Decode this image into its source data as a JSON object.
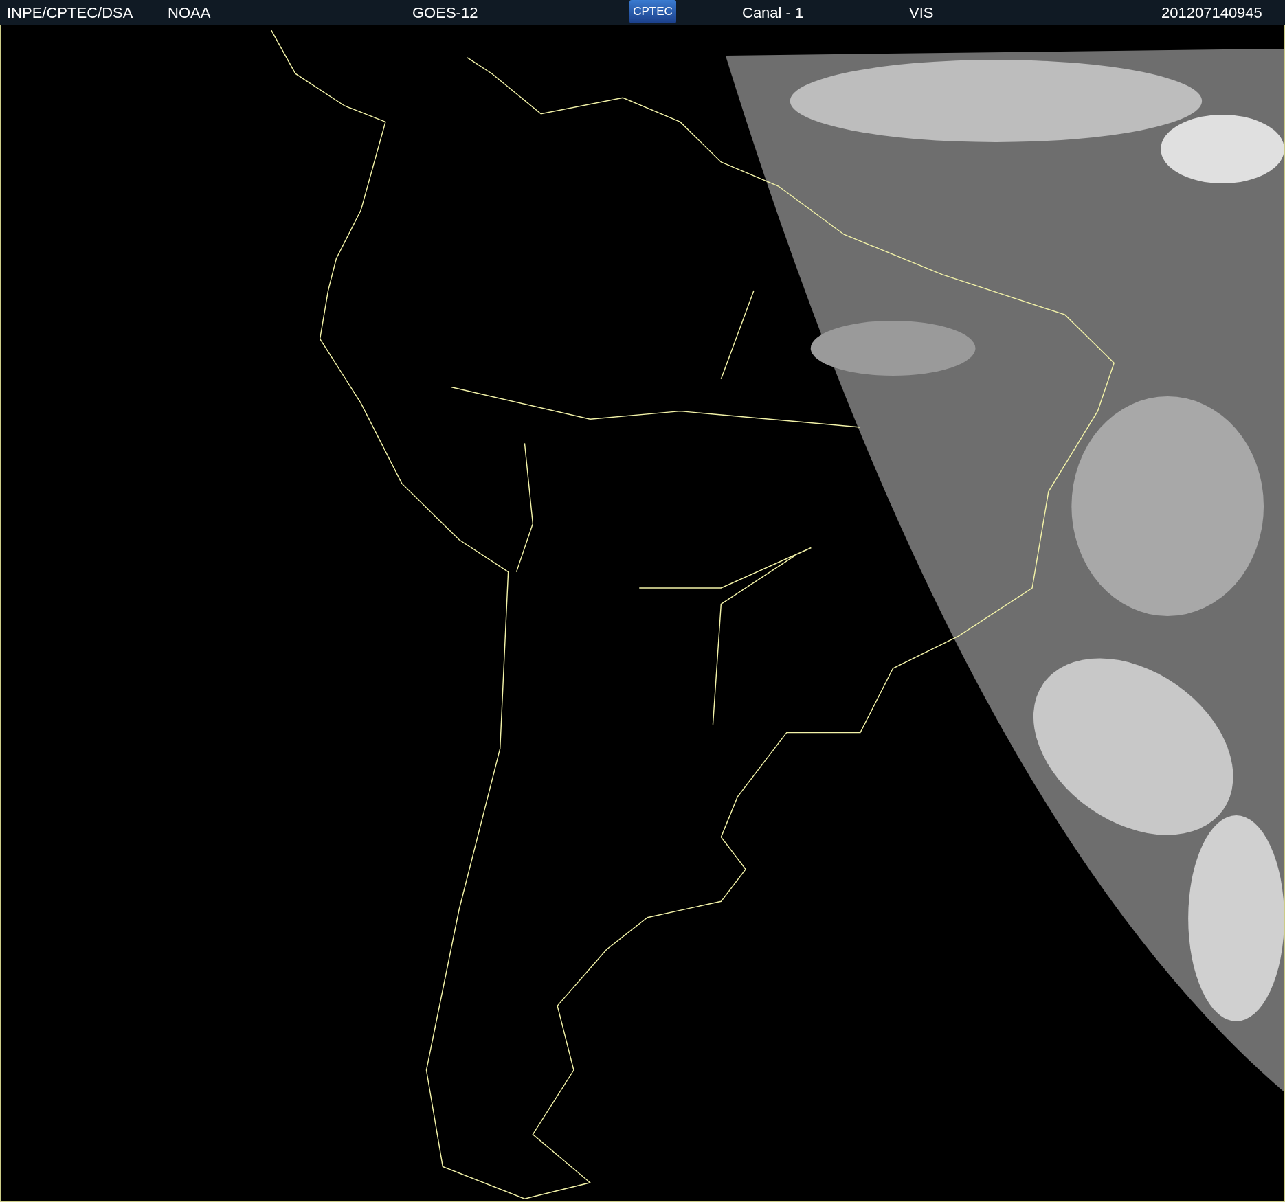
{
  "header": {
    "items": [
      {
        "kind": "text",
        "text": "INPE/CPTEC/DSA"
      },
      {
        "kind": "text",
        "text": "NOAA"
      },
      {
        "kind": "text",
        "text": "GOES-12"
      },
      {
        "kind": "logo",
        "text": "CPTEC"
      },
      {
        "kind": "text",
        "text": "Canal - 1"
      },
      {
        "kind": "text",
        "text": "VIS"
      },
      {
        "kind": "text",
        "text": "201207140945"
      }
    ]
  }
}
